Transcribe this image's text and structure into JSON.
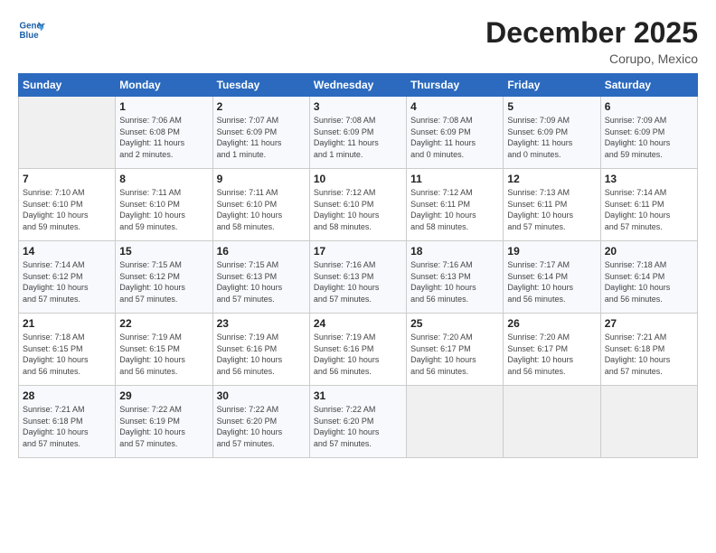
{
  "header": {
    "logo_line1": "General",
    "logo_line2": "Blue",
    "month": "December 2025",
    "location": "Corupo, Mexico"
  },
  "weekdays": [
    "Sunday",
    "Monday",
    "Tuesday",
    "Wednesday",
    "Thursday",
    "Friday",
    "Saturday"
  ],
  "weeks": [
    [
      {
        "day": "",
        "info": ""
      },
      {
        "day": "1",
        "info": "Sunrise: 7:06 AM\nSunset: 6:08 PM\nDaylight: 11 hours\nand 2 minutes."
      },
      {
        "day": "2",
        "info": "Sunrise: 7:07 AM\nSunset: 6:09 PM\nDaylight: 11 hours\nand 1 minute."
      },
      {
        "day": "3",
        "info": "Sunrise: 7:08 AM\nSunset: 6:09 PM\nDaylight: 11 hours\nand 1 minute."
      },
      {
        "day": "4",
        "info": "Sunrise: 7:08 AM\nSunset: 6:09 PM\nDaylight: 11 hours\nand 0 minutes."
      },
      {
        "day": "5",
        "info": "Sunrise: 7:09 AM\nSunset: 6:09 PM\nDaylight: 11 hours\nand 0 minutes."
      },
      {
        "day": "6",
        "info": "Sunrise: 7:09 AM\nSunset: 6:09 PM\nDaylight: 10 hours\nand 59 minutes."
      }
    ],
    [
      {
        "day": "7",
        "info": ""
      },
      {
        "day": "8",
        "info": "Sunrise: 7:11 AM\nSunset: 6:10 PM\nDaylight: 10 hours\nand 59 minutes."
      },
      {
        "day": "9",
        "info": "Sunrise: 7:11 AM\nSunset: 6:10 PM\nDaylight: 10 hours\nand 58 minutes."
      },
      {
        "day": "10",
        "info": "Sunrise: 7:12 AM\nSunset: 6:10 PM\nDaylight: 10 hours\nand 58 minutes."
      },
      {
        "day": "11",
        "info": "Sunrise: 7:12 AM\nSunset: 6:11 PM\nDaylight: 10 hours\nand 58 minutes."
      },
      {
        "day": "12",
        "info": "Sunrise: 7:13 AM\nSunset: 6:11 PM\nDaylight: 10 hours\nand 57 minutes."
      },
      {
        "day": "13",
        "info": "Sunrise: 7:14 AM\nSunset: 6:11 PM\nDaylight: 10 hours\nand 57 minutes."
      }
    ],
    [
      {
        "day": "14",
        "info": ""
      },
      {
        "day": "15",
        "info": "Sunrise: 7:15 AM\nSunset: 6:12 PM\nDaylight: 10 hours\nand 57 minutes."
      },
      {
        "day": "16",
        "info": "Sunrise: 7:15 AM\nSunset: 6:13 PM\nDaylight: 10 hours\nand 57 minutes."
      },
      {
        "day": "17",
        "info": "Sunrise: 7:16 AM\nSunset: 6:13 PM\nDaylight: 10 hours\nand 57 minutes."
      },
      {
        "day": "18",
        "info": "Sunrise: 7:16 AM\nSunset: 6:13 PM\nDaylight: 10 hours\nand 56 minutes."
      },
      {
        "day": "19",
        "info": "Sunrise: 7:17 AM\nSunset: 6:14 PM\nDaylight: 10 hours\nand 56 minutes."
      },
      {
        "day": "20",
        "info": "Sunrise: 7:18 AM\nSunset: 6:14 PM\nDaylight: 10 hours\nand 56 minutes."
      }
    ],
    [
      {
        "day": "21",
        "info": ""
      },
      {
        "day": "22",
        "info": "Sunrise: 7:19 AM\nSunset: 6:15 PM\nDaylight: 10 hours\nand 56 minutes."
      },
      {
        "day": "23",
        "info": "Sunrise: 7:19 AM\nSunset: 6:16 PM\nDaylight: 10 hours\nand 56 minutes."
      },
      {
        "day": "24",
        "info": "Sunrise: 7:19 AM\nSunset: 6:16 PM\nDaylight: 10 hours\nand 56 minutes."
      },
      {
        "day": "25",
        "info": "Sunrise: 7:20 AM\nSunset: 6:17 PM\nDaylight: 10 hours\nand 56 minutes."
      },
      {
        "day": "26",
        "info": "Sunrise: 7:20 AM\nSunset: 6:17 PM\nDaylight: 10 hours\nand 56 minutes."
      },
      {
        "day": "27",
        "info": "Sunrise: 7:21 AM\nSunset: 6:18 PM\nDaylight: 10 hours\nand 57 minutes."
      }
    ],
    [
      {
        "day": "28",
        "info": "Sunrise: 7:21 AM\nSunset: 6:18 PM\nDaylight: 10 hours\nand 57 minutes."
      },
      {
        "day": "29",
        "info": "Sunrise: 7:22 AM\nSunset: 6:19 PM\nDaylight: 10 hours\nand 57 minutes."
      },
      {
        "day": "30",
        "info": "Sunrise: 7:22 AM\nSunset: 6:20 PM\nDaylight: 10 hours\nand 57 minutes."
      },
      {
        "day": "31",
        "info": "Sunrise: 7:22 AM\nSunset: 6:20 PM\nDaylight: 10 hours\nand 57 minutes."
      },
      {
        "day": "",
        "info": ""
      },
      {
        "day": "",
        "info": ""
      },
      {
        "day": "",
        "info": ""
      }
    ]
  ],
  "sunday_info": {
    "7": "Sunrise: 7:10 AM\nSunset: 6:10 PM\nDaylight: 10 hours\nand 59 minutes.",
    "14": "Sunrise: 7:14 AM\nSunset: 6:12 PM\nDaylight: 10 hours\nand 57 minutes.",
    "21": "Sunrise: 7:18 AM\nSunset: 6:15 PM\nDaylight: 10 hours\nand 56 minutes."
  }
}
